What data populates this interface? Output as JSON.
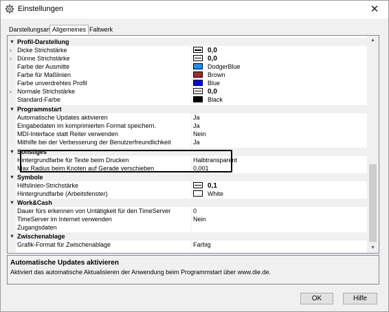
{
  "window": {
    "title": "Einstellungen",
    "close_glyph": "✕"
  },
  "tabs": [
    "Darstellungsart",
    "Allgemeines",
    "Faltwerk"
  ],
  "categories": {
    "profil": "Profil-Darstellung",
    "programmstart": "Programmstart",
    "sonstiges": "Sonstiges",
    "symbole": "Symbole",
    "workcash": "Work&Cash",
    "zwischenablage": "Zwischenablage"
  },
  "props": {
    "dicke": {
      "name": "Dicke Strichstärke",
      "value": "0,0"
    },
    "duenne": {
      "name": "Dünne Strichstärke",
      "value": "0,0"
    },
    "ausmitte": {
      "name": "Farbe der Ausmitte",
      "value": "DodgerBlue",
      "color": "#1e90ff"
    },
    "masslinien": {
      "name": "Farbe für Maßlinien",
      "value": "Brown",
      "color": "#a52a2a"
    },
    "unverdreht": {
      "name": "Farbe unverdrehtes Profil",
      "value": "Blue",
      "color": "#0000ff"
    },
    "normale": {
      "name": "Normale Strichstärke",
      "value": "0,0"
    },
    "standard": {
      "name": "Standard-Farbe",
      "value": "Black",
      "color": "#000000"
    },
    "autoupdate": {
      "name": "Automatische Updates aktivieren",
      "value": "Ja"
    },
    "eingabedaten": {
      "name": "Eingabedaten im komprimierten Format speichern.",
      "value": "Ja"
    },
    "mdi": {
      "name": "MDI-Interface statt Reiter verwenden",
      "value": "Nein"
    },
    "mithilfe": {
      "name": "Mithilfe bei der Verbesserung der Benutzerfreundlichkeit",
      "value": "Ja"
    },
    "hintergrunddruck": {
      "name": "Hintergrundfarbe für Texte beim Drucken",
      "value": "Halbtransparent"
    },
    "maxradius": {
      "name": "Max Radius beim Knoten auf Gerade verschieben",
      "value": "0,001"
    },
    "hilfslinien": {
      "name": "Hilfslinien-Strichstärke",
      "value": "0,1"
    },
    "hintergrundarbeit": {
      "name": "Hintergrundfarbe (Arbeitsfenster)",
      "value": "White",
      "color": "#ffffff"
    },
    "dauer": {
      "name": "Dauer fürs erkennen von Untätigkeit für den TimeServer",
      "value": "0"
    },
    "timeserver": {
      "name": "TimeServer im Internet verwenden",
      "value": "Nein"
    },
    "zugangsdaten": {
      "name": "Zugangsdaten",
      "value": ""
    },
    "grafikformat": {
      "name": "Grafik-Format für Zwischenablage",
      "value": "Farbig"
    }
  },
  "help": {
    "title": "Automatische Updates aktivieren",
    "description": "Aktiviert das automatische Aktualisieren der Anwendung beim Programmstart über www.die.de."
  },
  "buttons": {
    "ok": "OK",
    "help": "Hilfe"
  },
  "icons": {
    "title": "gear-icon",
    "category_toggle": "collapse-chevron-icon",
    "expand": "chevron-right-icon",
    "scroll_up": "arrow-up-icon",
    "scroll_down": "arrow-down-icon"
  }
}
